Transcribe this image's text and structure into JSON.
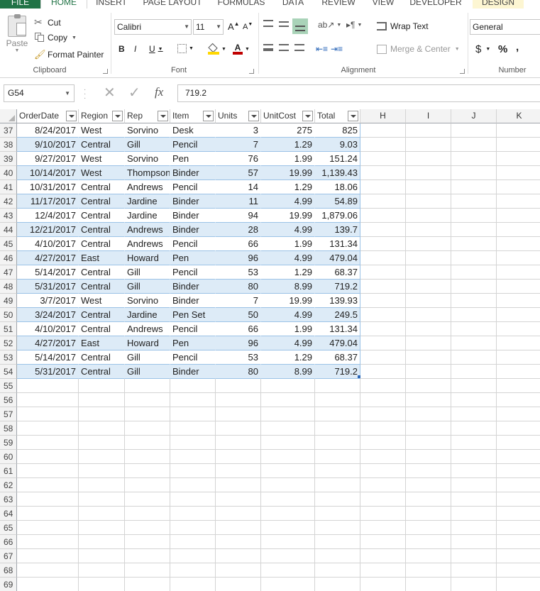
{
  "tabs": [
    "FILE",
    "HOME",
    "INSERT",
    "PAGE LAYOUT",
    "FORMULAS",
    "DATA",
    "REVIEW",
    "VIEW",
    "DEVELOPER",
    "DESIGN"
  ],
  "ribbon": {
    "clipboard": {
      "paste": "Paste",
      "cut": "Cut",
      "copy": "Copy",
      "format_painter": "Format Painter",
      "label": "Clipboard"
    },
    "font": {
      "name": "Calibri",
      "size": "11",
      "bold": "B",
      "italic": "I",
      "underline": "U",
      "grow": "A",
      "shrink": "A",
      "color_letter": "A",
      "label": "Font"
    },
    "alignment": {
      "wrap": "Wrap Text",
      "merge": "Merge & Center",
      "label": "Alignment"
    },
    "number": {
      "format": "General",
      "currency": "$",
      "percent": "%",
      "comma": ",",
      "label": "Number"
    }
  },
  "formula_bar": {
    "name_box": "G54",
    "fx": "fx",
    "value": "719.2"
  },
  "columns": {
    "headers": [
      "OrderDate",
      "Region",
      "Rep",
      "Item",
      "Units",
      "UnitCost",
      "Total",
      "H",
      "I",
      "J",
      "K"
    ]
  },
  "rows": [
    {
      "n": "37",
      "cells": [
        "8/24/2017",
        "West",
        "Sorvino",
        "Desk",
        "3",
        "275",
        "825"
      ]
    },
    {
      "n": "38",
      "cells": [
        "9/10/2017",
        "Central",
        "Gill",
        "Pencil",
        "7",
        "1.29",
        "9.03"
      ]
    },
    {
      "n": "39",
      "cells": [
        "9/27/2017",
        "West",
        "Sorvino",
        "Pen",
        "76",
        "1.99",
        "151.24"
      ]
    },
    {
      "n": "40",
      "cells": [
        "10/14/2017",
        "West",
        "Thompson",
        "Binder",
        "57",
        "19.99",
        "1,139.43"
      ]
    },
    {
      "n": "41",
      "cells": [
        "10/31/2017",
        "Central",
        "Andrews",
        "Pencil",
        "14",
        "1.29",
        "18.06"
      ]
    },
    {
      "n": "42",
      "cells": [
        "11/17/2017",
        "Central",
        "Jardine",
        "Binder",
        "11",
        "4.99",
        "54.89"
      ]
    },
    {
      "n": "43",
      "cells": [
        "12/4/2017",
        "Central",
        "Jardine",
        "Binder",
        "94",
        "19.99",
        "1,879.06"
      ]
    },
    {
      "n": "44",
      "cells": [
        "12/21/2017",
        "Central",
        "Andrews",
        "Binder",
        "28",
        "4.99",
        "139.7"
      ]
    },
    {
      "n": "45",
      "cells": [
        "4/10/2017",
        "Central",
        "Andrews",
        "Pencil",
        "66",
        "1.99",
        "131.34"
      ]
    },
    {
      "n": "46",
      "cells": [
        "4/27/2017",
        "East",
        "Howard",
        "Pen",
        "96",
        "4.99",
        "479.04"
      ]
    },
    {
      "n": "47",
      "cells": [
        "5/14/2017",
        "Central",
        "Gill",
        "Pencil",
        "53",
        "1.29",
        "68.37"
      ]
    },
    {
      "n": "48",
      "cells": [
        "5/31/2017",
        "Central",
        "Gill",
        "Binder",
        "80",
        "8.99",
        "719.2"
      ]
    },
    {
      "n": "49",
      "cells": [
        "3/7/2017",
        "West",
        "Sorvino",
        "Binder",
        "7",
        "19.99",
        "139.93"
      ]
    },
    {
      "n": "50",
      "cells": [
        "3/24/2017",
        "Central",
        "Jardine",
        "Pen Set",
        "50",
        "4.99",
        "249.5"
      ]
    },
    {
      "n": "51",
      "cells": [
        "4/10/2017",
        "Central",
        "Andrews",
        "Pencil",
        "66",
        "1.99",
        "131.34"
      ]
    },
    {
      "n": "52",
      "cells": [
        "4/27/2017",
        "East",
        "Howard",
        "Pen",
        "96",
        "4.99",
        "479.04"
      ]
    },
    {
      "n": "53",
      "cells": [
        "5/14/2017",
        "Central",
        "Gill",
        "Pencil",
        "53",
        "1.29",
        "68.37"
      ]
    },
    {
      "n": "54",
      "cells": [
        "5/31/2017",
        "Central",
        "Gill",
        "Binder",
        "80",
        "8.99",
        "719.2"
      ]
    }
  ],
  "empty_rows": [
    "55",
    "56",
    "57",
    "58",
    "59",
    "60",
    "61",
    "62",
    "63",
    "64",
    "65",
    "66",
    "67",
    "68",
    "69"
  ]
}
